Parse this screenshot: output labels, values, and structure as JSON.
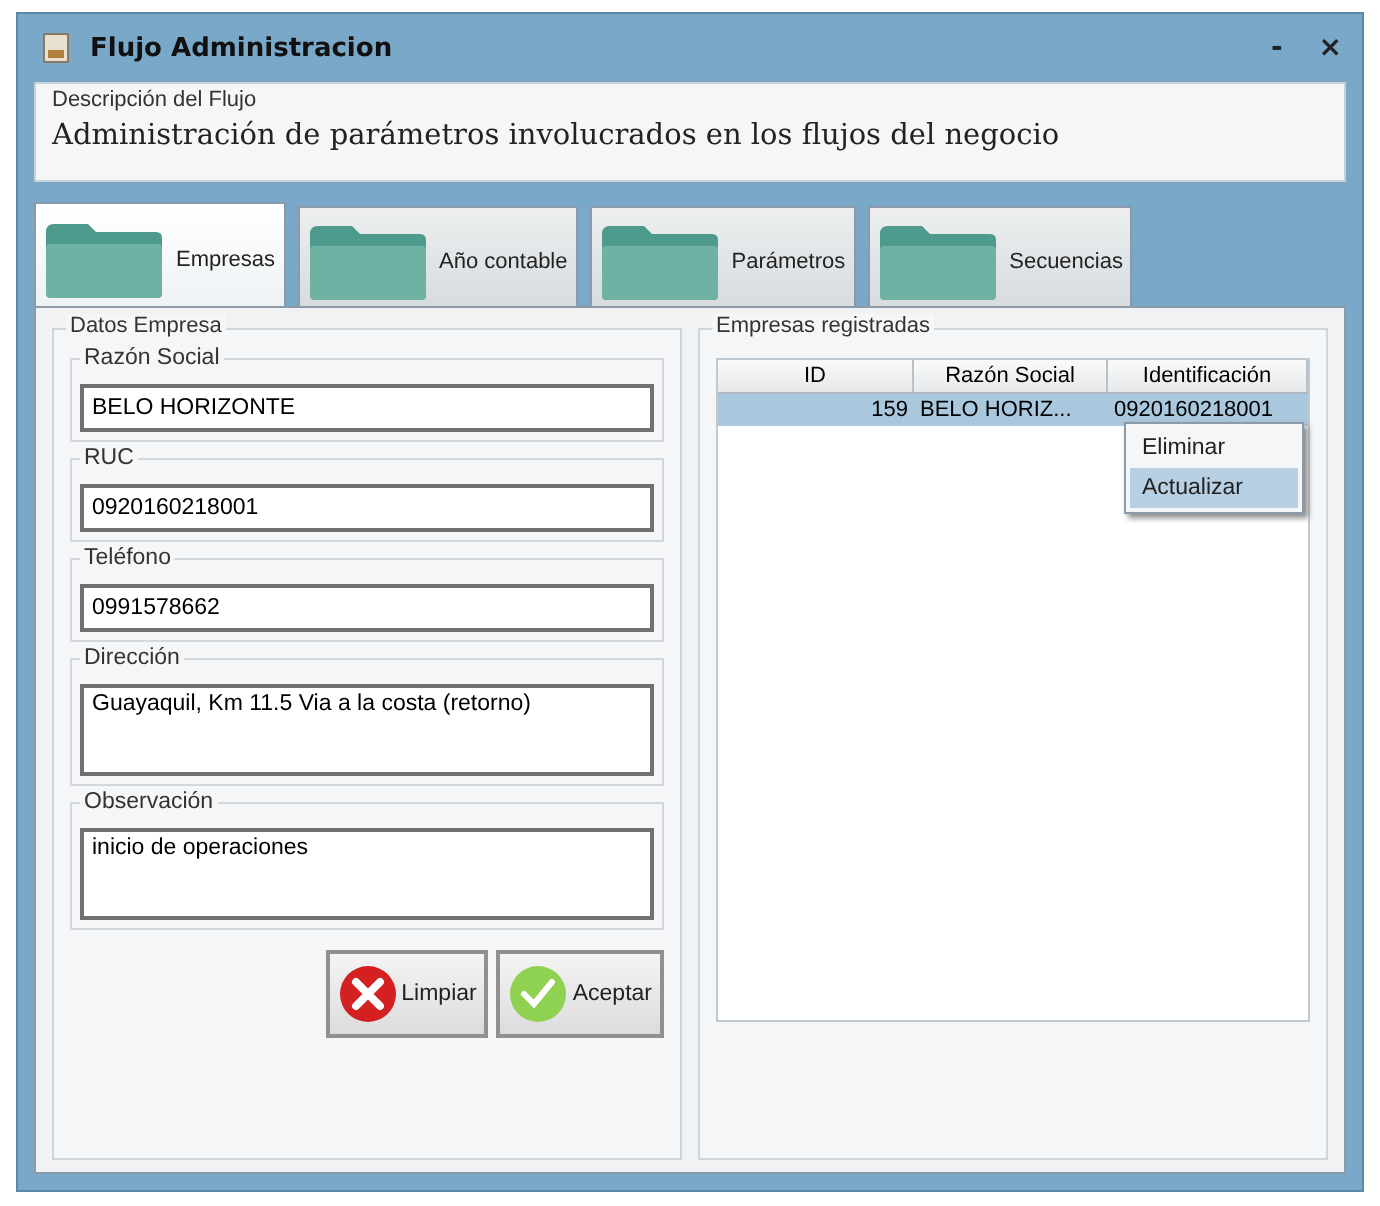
{
  "window": {
    "title": "Flujo Administracion",
    "buttons": [
      "-",
      "×"
    ]
  },
  "description": {
    "legend": "Descripción del Flujo",
    "text": "Administración de parámetros involucrados en los flujos del negocio"
  },
  "tabs": [
    {
      "label": "Empresas",
      "selected": true
    },
    {
      "label": "Año contable",
      "selected": false
    },
    {
      "label": "Parámetros",
      "selected": false
    },
    {
      "label": "Secuencias",
      "selected": false
    }
  ],
  "form": {
    "legend": "Datos Empresa",
    "fields": [
      {
        "label": "Razón Social",
        "value": "BELO HORIZONTE",
        "kind": "line"
      },
      {
        "label": "RUC",
        "value": "0920160218001",
        "kind": "line"
      },
      {
        "label": "Teléfono",
        "value": "0991578662",
        "kind": "line"
      },
      {
        "label": "Dirección",
        "value": "Guayaquil, Km 11.5 Via a la costa (retorno)",
        "kind": "area"
      },
      {
        "label": "Observación",
        "value": "inicio de operaciones",
        "kind": "area"
      }
    ],
    "buttons": [
      {
        "label": "Limpiar",
        "kind": "clear"
      },
      {
        "label": "Aceptar",
        "kind": "accept"
      }
    ]
  },
  "table": {
    "legend": "Empresas registradas",
    "columns": [
      "ID",
      "Razón Social",
      "Identificación"
    ],
    "rows": [
      {
        "cells": [
          "159",
          "BELO HORIZ...",
          "0920160218001"
        ],
        "selected": true
      }
    ]
  },
  "context_menu": {
    "items": [
      {
        "label": "Eliminar",
        "selected": false
      },
      {
        "label": "Actualizar",
        "selected": true
      }
    ]
  }
}
